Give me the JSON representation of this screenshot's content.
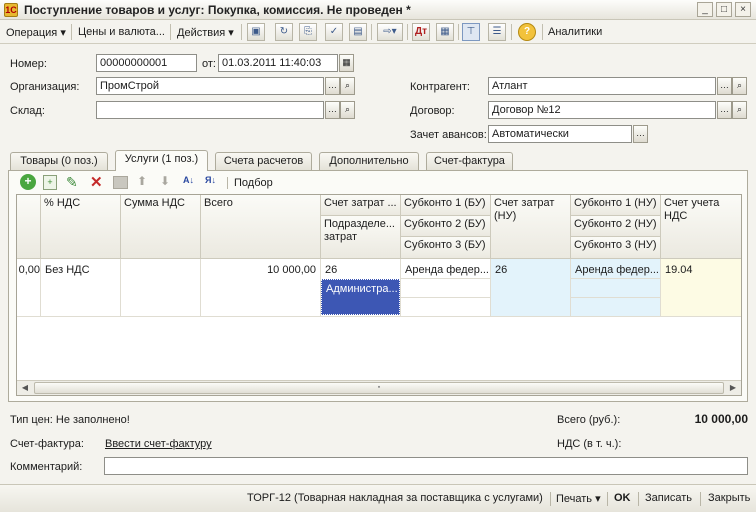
{
  "window": {
    "title": "Поступление товаров и услуг: Покупка, комиссия. Не проведен *",
    "app_icon_glyph": "1С",
    "btn_min": "_",
    "btn_max": "□",
    "btn_close": "×"
  },
  "toolbar": {
    "operation": "Операция ▾",
    "prices": "Цены и валюта...",
    "actions": "Действия ▾",
    "analytics": "Аналитики",
    "icons": [
      "save-icon",
      "refresh-icon",
      "copy-doc-icon",
      "post-icon",
      "clear-post-icon",
      "goto-icon",
      "dt-kt-icon",
      "print-doc-icon",
      "structure-icon",
      "list-icon",
      "help-icon"
    ]
  },
  "header": {
    "number_label": "Номер:",
    "number_value": "00000000001",
    "date_label": "от:",
    "date_value": "01.03.2011 11:40:03",
    "org_label": "Организация:",
    "org_value": "ПромСтрой",
    "warehouse_label": "Склад:",
    "warehouse_value": "",
    "contractor_label": "Контрагент:",
    "contractor_value": "Атлант",
    "contract_label": "Договор:",
    "contract_value": "Договор №12",
    "advance_label": "Зачет авансов:",
    "advance_value": "Автоматически"
  },
  "tabs": [
    {
      "label": "Товары (0 поз.)"
    },
    {
      "label": "Услуги (1 поз.)"
    },
    {
      "label": "Счета расчетов"
    },
    {
      "label": "Дополнительно"
    },
    {
      "label": "Счет-фактура"
    }
  ],
  "grid_toolbar": {
    "selection": "Подбор",
    "sort_asc": "А↓",
    "sort_desc": "Я↓"
  },
  "grid": {
    "headers": {
      "vat_rate": "% НДС",
      "vat_sum": "Сумма НДС",
      "total": "Всего",
      "cost_account": "Счет затрат ...",
      "subdivision": "Подразделе... затрат",
      "subconto1_bu": "Субконто 1 (БУ)",
      "subconto2_bu": "Субконто 2 (БУ)",
      "subconto3_bu": "Субконто 3 (БУ)",
      "cost_account_nu": "Счет затрат (НУ)",
      "subconto1_nu": "Субконто 1 (НУ)",
      "subconto2_nu": "Субконто 2 (НУ)",
      "subconto3_nu": "Субконто 3 (НУ)",
      "vat_account": "Счет учета НДС"
    },
    "row": {
      "amount_tail": "0,00",
      "vat_rate": "Без НДС",
      "vat_sum": "",
      "total": "10 000,00",
      "cost_account": "26",
      "subdivision": "Администра...",
      "subconto1_bu": "Аренда федер...",
      "cost_account_nu": "26",
      "subconto1_nu": "Аренда федер...",
      "vat_account": "19.04"
    }
  },
  "summary": {
    "price_type": "Тип цен: Не заполнено!",
    "total_label": "Всего (руб.):",
    "total_value": "10 000,00",
    "invoice_label": "Счет-фактура:",
    "invoice_link": "Ввести счет-фактуру",
    "vat_label": "НДС (в т. ч.):",
    "vat_value": "",
    "comment_label": "Комментарий:",
    "comment_value": ""
  },
  "footer": {
    "torg12": "ТОРГ-12 (Товарная накладная за поставщика с услугами)",
    "print": "Печать ▾",
    "ok": "OK",
    "save": "Записать",
    "close": "Закрыть"
  },
  "colors": {
    "accent_selection": "#3d57b4",
    "nu_column_bg": "#e3f3fb",
    "vat_column_bg": "#fdfbe4"
  }
}
